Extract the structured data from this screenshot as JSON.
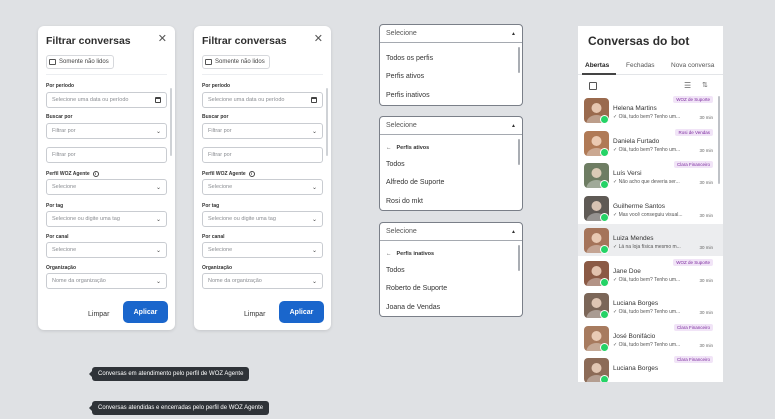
{
  "filter_panels": [
    {
      "title": "Filtrar conversas",
      "chip": "Somente não lidos",
      "period_label": "Por período",
      "period_placeholder": "Selecione uma data ou período",
      "search_label": "Buscar por",
      "search_placeholder": "Filtrar por",
      "search_input": "Filtrar por",
      "profile_label": "Perfil WOZ Agente",
      "profile_value": "Selecione",
      "tag_label": "Por tag",
      "tag_value": "Selecione ou digite uma tag",
      "channel_label": "Por canal",
      "channel_value": "Selecione",
      "org_label": "Organização",
      "org_value": "Nome da organização",
      "clear": "Limpar",
      "apply": "Aplicar"
    },
    {
      "title": "Filtrar conversas",
      "chip": "Somente não lidos",
      "period_label": "Por período",
      "period_placeholder": "Selecione uma data ou período",
      "search_label": "Buscar por",
      "search_placeholder": "Filtrar por",
      "search_input": "Filtrar por",
      "profile_label": "Perfil WOZ Agente",
      "profile_value": "Selecione",
      "tag_label": "Por tag",
      "tag_value": "Selecione ou digite uma tag",
      "channel_label": "Por canal",
      "channel_value": "Selecione",
      "org_label": "Organização",
      "org_value": "Nome da organização",
      "clear": "Limpar",
      "apply": "Aplicar"
    }
  ],
  "dropdowns": [
    {
      "header": "Selecione",
      "back": "",
      "items": [
        "Todos os perfis",
        "Perfis ativos",
        "Perfis inativos"
      ]
    },
    {
      "header": "Selecione",
      "back": "Perfis ativos",
      "items": [
        "Todos",
        "Alfredo de Suporte",
        "Rosi do mkt"
      ]
    },
    {
      "header": "Selecione",
      "back": "Perfis inativos",
      "items": [
        "Todos",
        "Roberto de Suporte",
        "Joana de Vendas"
      ]
    }
  ],
  "conversations": {
    "title": "Conversas do bot",
    "tabs": [
      "Abertas",
      "Fechadas",
      "Nova conversa"
    ],
    "items": [
      {
        "name": "Helena Martins",
        "preview": "✓ Olá, tudo bem? Tenho um...",
        "time": "30 min",
        "badge": "WOZ de Suporte",
        "selected": false,
        "color": "#9a6a4e"
      },
      {
        "name": "Daniela Furtado",
        "preview": "✓ Olá, tudo bem? Tenho um...",
        "time": "30 min",
        "badge": "Rosi de Vendas",
        "selected": false,
        "color": "#b07a56"
      },
      {
        "name": "Luís Versi",
        "preview": "✓ Não acho que deveria ser...",
        "time": "30 min",
        "badge": "Clara Financeiro",
        "selected": false,
        "color": "#6e7d63"
      },
      {
        "name": "Guilherme Santos",
        "preview": "✓ Mas você conseguiu visual...",
        "time": "30 min",
        "badge": "",
        "selected": false,
        "color": "#5f5a55"
      },
      {
        "name": "Luiza Mendes",
        "preview": "✓ Lá na loja física mesmo m...",
        "time": "30 min",
        "badge": "",
        "selected": true,
        "color": "#a5745a"
      },
      {
        "name": "Jane Doe",
        "preview": "✓ Olá, tudo bem? Tenho um...",
        "time": "30 min",
        "badge": "WOZ de Suporte",
        "selected": false,
        "color": "#8b5a45"
      },
      {
        "name": "Luciana Borges",
        "preview": "✓ Olá, tudo bem? Tenho um...",
        "time": "30 min",
        "badge": "",
        "selected": false,
        "color": "#7b6658"
      },
      {
        "name": "José Bonifácio",
        "preview": "✓ Olá, tudo bem? Tenho um...",
        "time": "30 min",
        "badge": "Clara Financeiro",
        "selected": false,
        "color": "#a77b5f"
      },
      {
        "name": "Luciana Borges",
        "preview": "",
        "time": "",
        "badge": "Clara Financeiro",
        "selected": false,
        "color": "#8c6b57"
      }
    ]
  },
  "tooltips": [
    "Conversas em atendimento pelo perfil de WOZ Agente",
    "Conversas atendidas e encerradas pelo perfil de WOZ Agente"
  ]
}
